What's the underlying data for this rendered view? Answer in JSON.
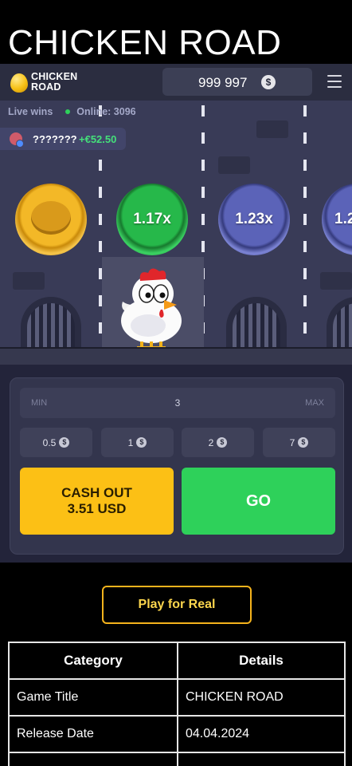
{
  "page": {
    "title": "CHICKEN ROAD"
  },
  "header": {
    "logo_text": "CHICKEN\nROAD",
    "balance": "999 997",
    "currency_symbol": "$"
  },
  "live": {
    "live_wins_label": "Live wins",
    "online_label": "Online: 3096",
    "winner_name": "???????",
    "winner_amount": "+€52.50"
  },
  "multipliers": {
    "current": "1.17x",
    "next": "1.23x",
    "far": "1.2"
  },
  "controls": {
    "min_label": "MIN",
    "bet_value": "3",
    "max_label": "MAX",
    "quick_bets": [
      "0.5",
      "1",
      "2",
      "7"
    ],
    "cashout_label": "CASH OUT",
    "cashout_amount": "3.51 USD",
    "go_label": "GO"
  },
  "cta": {
    "play_real": "Play for Real"
  },
  "info_table": {
    "headers": [
      "Category",
      "Details"
    ],
    "rows": [
      [
        "Game Title",
        "CHICKEN ROAD"
      ],
      [
        "Release Date",
        "04.04.2024"
      ]
    ]
  },
  "colors": {
    "accent_yellow": "#fcc015",
    "go_green": "#2ed15a",
    "win_green": "#44e07a",
    "road_bg": "#393b57"
  }
}
